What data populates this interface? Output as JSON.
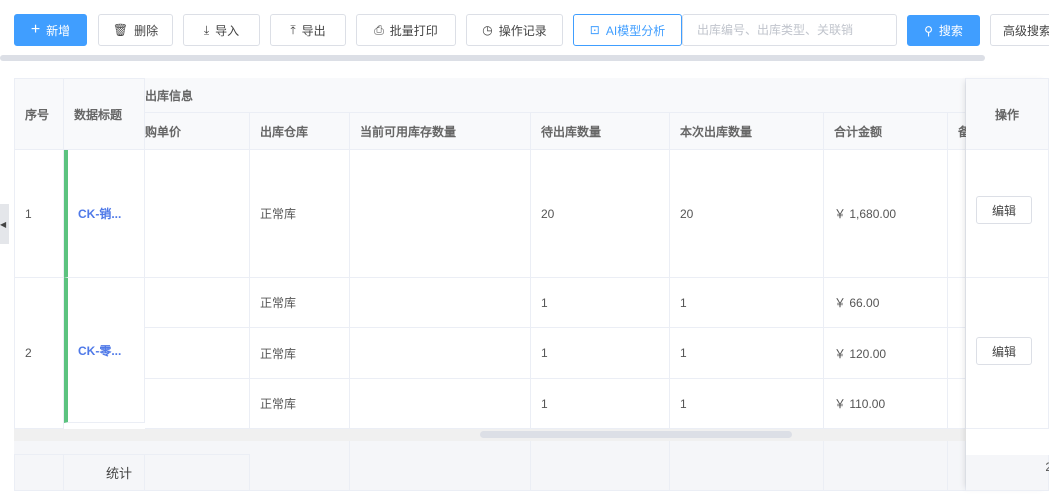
{
  "toolbar": {
    "add": "新增",
    "delete": "删除",
    "import": "导入",
    "export": "导出",
    "batch_print": "批量打印",
    "op_log": "操作记录",
    "ai": "AI模型分析",
    "search_placeholder": "出库编号、出库类型、关联销",
    "search": "搜索",
    "advanced": "高级搜索"
  },
  "table": {
    "headers": {
      "seq": "序号",
      "title": "数据标题",
      "group": "出库信息",
      "unit_price": "购单价",
      "warehouse": "出库仓库",
      "available": "当前可用库存数量",
      "pending": "待出库数量",
      "this_qty": "本次出库数量",
      "total": "合计金额",
      "remark": "备",
      "action": "操作"
    },
    "rows": [
      {
        "seq": "1",
        "title": "CK-销...",
        "accent": "#5cc37f",
        "items": [
          {
            "warehouse": "正常库",
            "pending": "20",
            "this_qty": "20",
            "total": "￥ 1,680.00"
          }
        ],
        "action": "编辑"
      },
      {
        "seq": "2",
        "title": "CK-零...",
        "accent": "#5cc37f",
        "items": [
          {
            "warehouse": "正常库",
            "pending": "1",
            "this_qty": "1",
            "total": "￥ 66.00"
          },
          {
            "warehouse": "正常库",
            "pending": "1",
            "this_qty": "1",
            "total": "￥ 120.00"
          },
          {
            "warehouse": "正常库",
            "pending": "1",
            "this_qty": "1",
            "total": "￥ 110.00"
          }
        ],
        "action": "编辑"
      }
    ],
    "footer_label": "统计",
    "footer_partial": "2"
  }
}
